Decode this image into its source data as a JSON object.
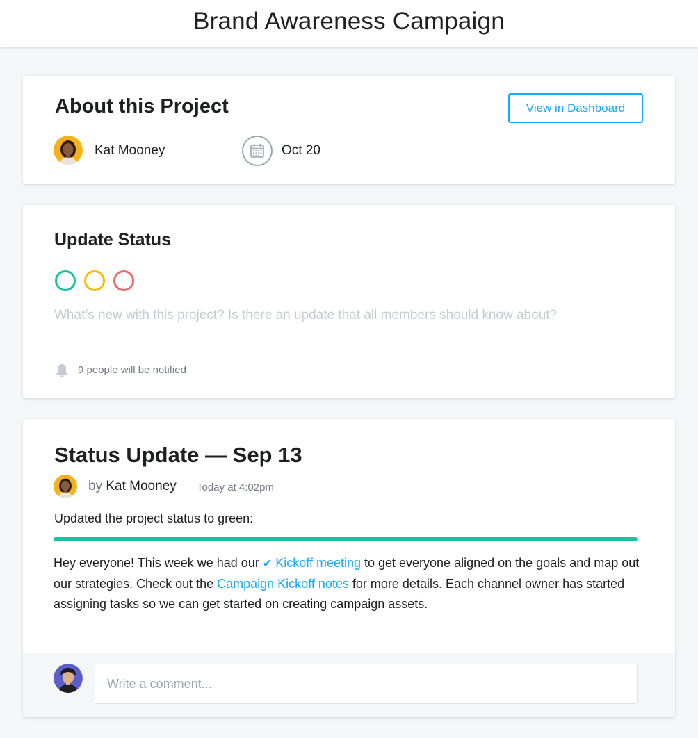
{
  "header": {
    "title": "Brand Awareness Campaign"
  },
  "about": {
    "title": "About this Project",
    "dashboard_button": "View in Dashboard",
    "owner": "Kat Mooney",
    "due_date": "Oct 20"
  },
  "update_status": {
    "title": "Update Status",
    "status_colors": {
      "green": "#14c3a0",
      "yellow": "#fcbd01",
      "red": "#f06a6a"
    },
    "placeholder": "What’s new with this project? Is there an update that all members should know about?",
    "notify_text": "9 people will be notified"
  },
  "post": {
    "title": "Status Update — Sep 13",
    "by": "by",
    "author": "Kat Mooney",
    "time": "Today at 4:02pm",
    "status_text": "Updated the project status to green:",
    "status_color": "#14c3a0",
    "body": {
      "part1": "Hey everyone! This week we had our ",
      "link1": "Kickoff meeting",
      "part2": " to get everyone aligned on the goals and map out our strategies. Check out the ",
      "link2": "Campaign Kickoff notes",
      "part3": " for more details. Each channel owner has started assigning tasks so we can get started on creating campaign assets."
    },
    "comment_placeholder": "Write a comment..."
  },
  "colors": {
    "accent": "#14aaf5"
  }
}
